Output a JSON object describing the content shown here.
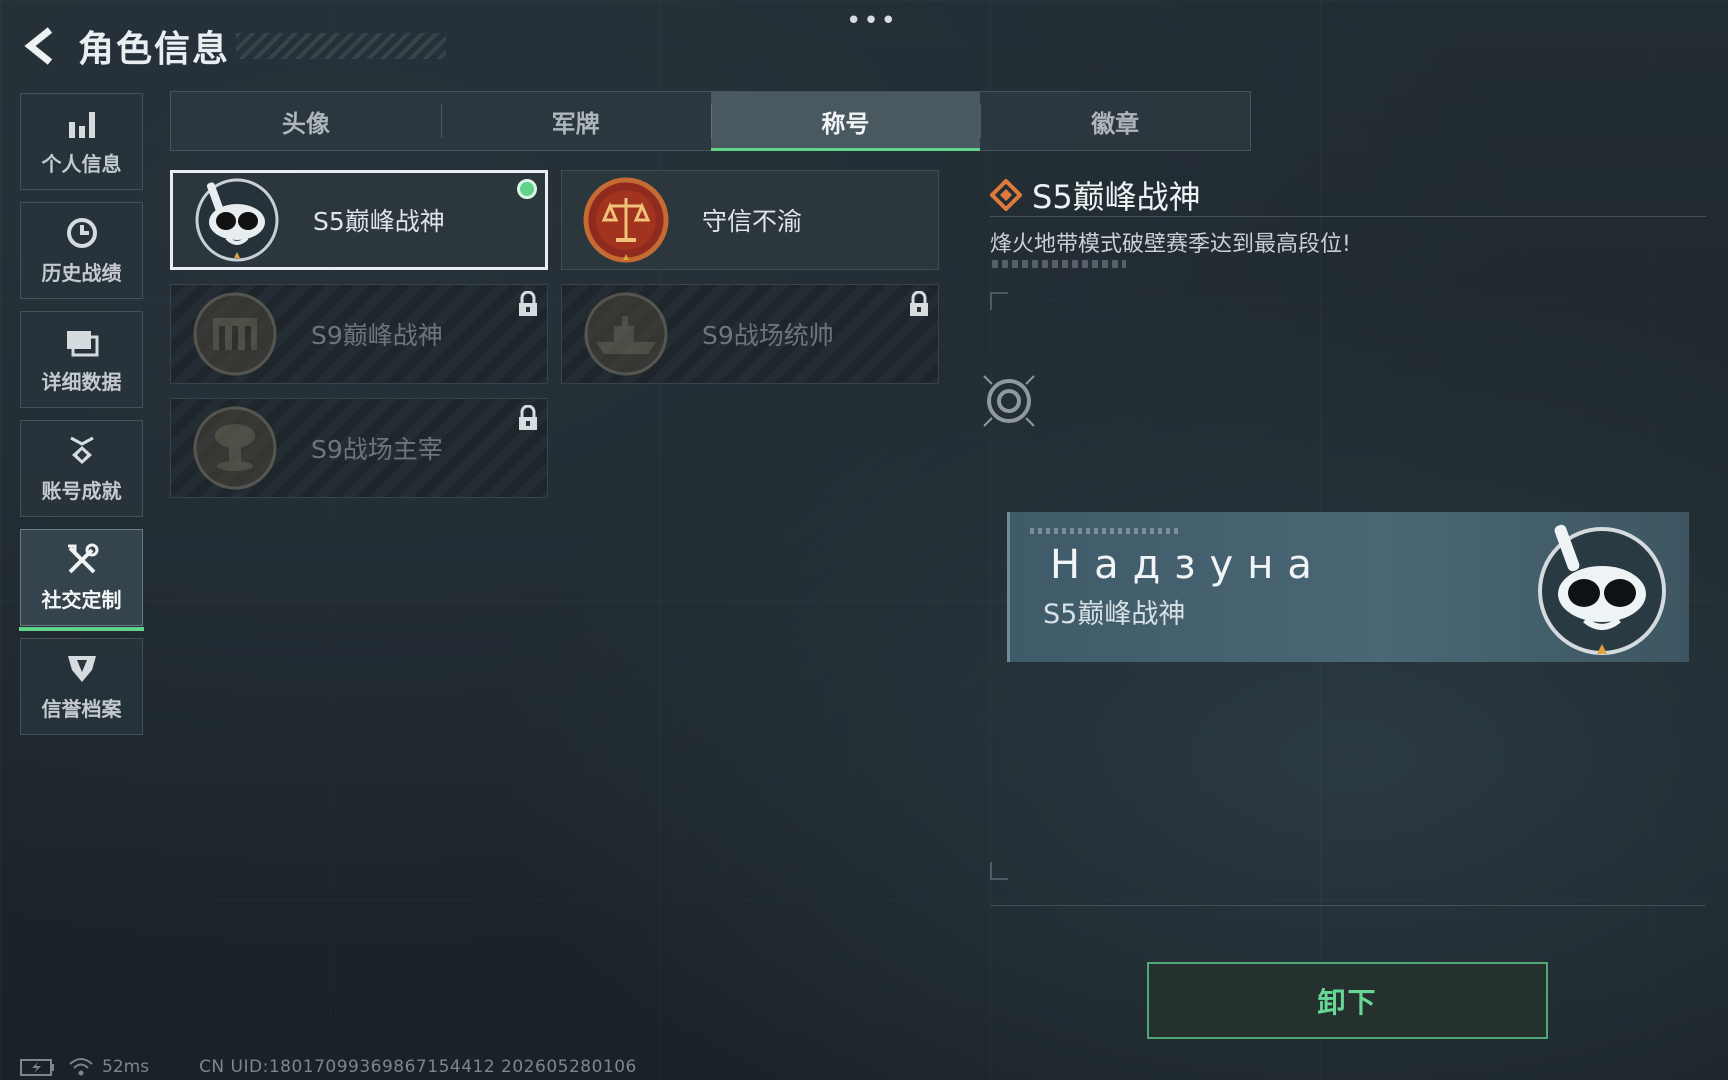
{
  "header": {
    "title": "角色信息",
    "back_icon": "back-arrow-icon",
    "more_icon": "more-dots-icon",
    "more_label": "•••"
  },
  "sidebar": {
    "items": [
      {
        "label": "个人信息",
        "icon": "bar-chart-icon",
        "active": false
      },
      {
        "label": "历史战绩",
        "icon": "clock-history-icon",
        "active": false
      },
      {
        "label": "详细数据",
        "icon": "folder-icon",
        "active": false
      },
      {
        "label": "账号成就",
        "icon": "achievement-medal-icon",
        "active": false
      },
      {
        "label": "社交定制",
        "icon": "tools-wrench-icon",
        "active": true
      },
      {
        "label": "信誉档案",
        "icon": "credit-shield-icon",
        "active": false
      }
    ]
  },
  "tabs": [
    {
      "label": "头像",
      "active": false
    },
    {
      "label": "军牌",
      "active": false
    },
    {
      "label": "称号",
      "active": true
    },
    {
      "label": "徽章",
      "active": false
    }
  ],
  "titles": [
    {
      "label": "S5巅峰战神",
      "locked": false,
      "selected": true,
      "equipped": true,
      "medal": "diver-mask-medal-icon"
    },
    {
      "label": "守信不渝",
      "locked": false,
      "selected": false,
      "equipped": false,
      "medal": "justice-scales-medal-icon"
    },
    {
      "label": "S9巅峰战神",
      "locked": true,
      "selected": false,
      "equipped": false,
      "medal": "fortress-medal-icon"
    },
    {
      "label": "S9战场统帅",
      "locked": true,
      "selected": false,
      "equipped": false,
      "medal": "warship-medal-icon"
    },
    {
      "label": "S9战场主宰",
      "locked": true,
      "selected": false,
      "equipped": false,
      "medal": "mushroom-cloud-medal-icon"
    }
  ],
  "detail": {
    "title": "S5巅峰战神",
    "description": "烽火地带模式破壁赛季达到最高段位!",
    "header_icon": "diamond-marker-icon"
  },
  "nameplate": {
    "player_name": "Надзуна",
    "title": "S5巅峰战神"
  },
  "actions": {
    "unequip_label": "卸下"
  },
  "status_bar": {
    "ping": "52ms",
    "uid": "CN UID:18017099369867154412 202605280106"
  },
  "colors": {
    "accent_green": "#5fd389",
    "equipped_dot": "#5fd389",
    "nameplate_bg": "#4a6775",
    "medal_orange": "#e07a3c"
  }
}
